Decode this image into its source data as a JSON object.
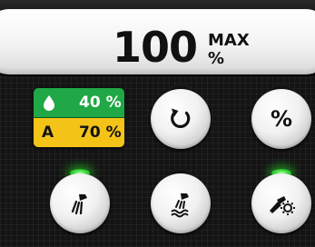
{
  "display": {
    "value": "100",
    "max_label": "MAX",
    "unit": "%"
  },
  "status": {
    "water": {
      "icon": "water-drop-icon",
      "value": "40 %",
      "color": "#1fa845"
    },
    "air": {
      "letter": "A",
      "value": "70 %",
      "color": "#f3c318"
    }
  },
  "buttons": {
    "reset": {
      "icon": "reset-icon",
      "led_on": false
    },
    "percent": {
      "label": "%",
      "led_on": false
    },
    "spray": {
      "icon": "spray-nozzle-icon",
      "led_on": true
    },
    "spray_water": {
      "icon": "spray-water-icon",
      "led_on": false
    },
    "spray_light": {
      "icon": "spray-light-icon",
      "led_on": true
    }
  },
  "colors": {
    "led_active": "#3cdd3c",
    "background": "#141414"
  }
}
